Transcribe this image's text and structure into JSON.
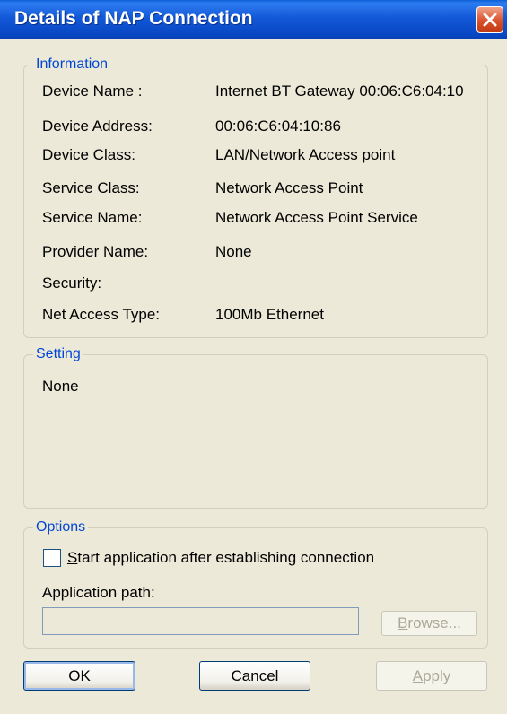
{
  "window": {
    "title": "Details of NAP Connection"
  },
  "information": {
    "legend": "Information",
    "rows": [
      {
        "label": "Device Name :",
        "value": "Internet BT Gateway  00:06:C6:04:10"
      },
      {
        "label": "Device Address:",
        "value": "00:06:C6:04:10:86"
      },
      {
        "label": "Device Class:",
        "value": "LAN/Network Access point"
      },
      {
        "label": "Service Class:",
        "value": "Network Access Point"
      },
      {
        "label": "Service Name:",
        "value": "Network Access Point Service"
      },
      {
        "label": "Provider Name:",
        "value": "None"
      },
      {
        "label": "Security:",
        "value": ""
      },
      {
        "label": "Net Access Type:",
        "value": "100Mb Ethernet"
      }
    ]
  },
  "setting": {
    "legend": "Setting",
    "value": "None"
  },
  "options": {
    "legend": "Options",
    "checkbox_label_first": "S",
    "checkbox_label_rest": "tart application after establishing connection",
    "checkbox_checked": false,
    "path_label": "Application path:",
    "path_value": "",
    "browse_first": "B",
    "browse_rest": "rowse..."
  },
  "buttons": {
    "ok": "OK",
    "cancel": "Cancel",
    "apply_first": "A",
    "apply_rest": "pply"
  }
}
